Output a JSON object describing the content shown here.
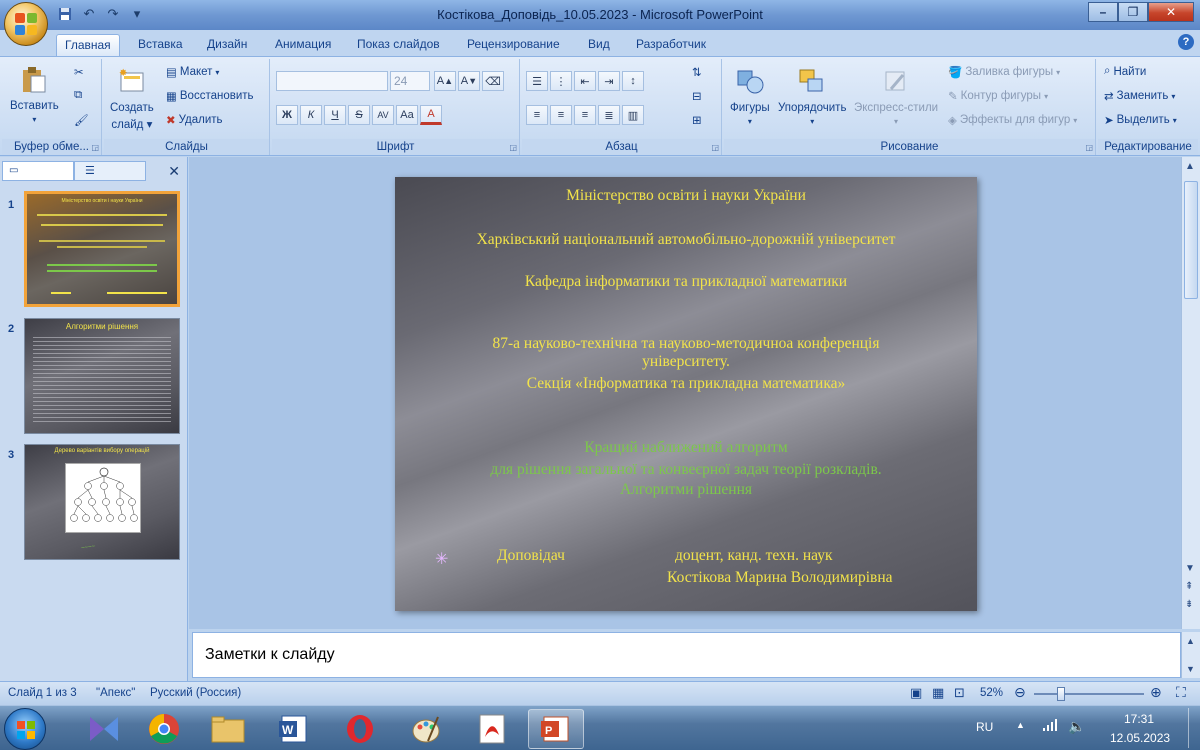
{
  "window": {
    "title": "Костікова_Доповідь_10.05.2023 - Microsoft PowerPoint"
  },
  "tabs": [
    "Главная",
    "Вставка",
    "Дизайн",
    "Анимация",
    "Показ слайдов",
    "Рецензирование",
    "Вид",
    "Разработчик"
  ],
  "active_tab": "Главная",
  "ribbon": {
    "clipboard": {
      "label": "Буфер обме...",
      "paste": "Вставить"
    },
    "slides": {
      "label": "Слайды",
      "create_line1": "Создать",
      "create_line2": "слайд",
      "layout": "Макет",
      "reset": "Восстановить",
      "delete": "Удалить"
    },
    "font": {
      "label": "Шрифт",
      "font_size": "24",
      "bold": "Ж",
      "italic": "К",
      "underline": "Ч",
      "strike": "S",
      "spacing": "AV",
      "case": "Аа"
    },
    "paragraph": {
      "label": "Абзац"
    },
    "drawing": {
      "label": "Рисование",
      "shapes": "Фигуры",
      "arrange": "Упорядочить",
      "quick_styles": "Экспресс-стили",
      "fill": "Заливка фигуры",
      "outline": "Контур фигуры",
      "effects": "Эффекты для фигур"
    },
    "editing": {
      "label": "Редактирование",
      "find": "Найти",
      "replace": "Заменить",
      "select": "Выделить"
    }
  },
  "thumbnails": [
    {
      "num": "1",
      "title": "Міністерство освіти і науки України",
      "selected": true
    },
    {
      "num": "2",
      "title": "Алгоритми рішення",
      "selected": false
    },
    {
      "num": "3",
      "title": "Дерево варіантів вибору операцій",
      "selected": false
    }
  ],
  "slide": {
    "ministry": "Міністерство освіти і науки України",
    "university": "Харківський національний автомобільно-дорожній університет",
    "department": "Кафедра інформатики та прикладної математики",
    "conference_line1": "87-а науково-технічна та науково-методичноа конференція",
    "conference_line2": "університету.",
    "section": "Секція «Інформатика та прикладна математика»",
    "topic_line1": "Кращий наближений алгоритм",
    "topic_line2": "для рішення загальної та конвеєрної задач теорії розкладів.",
    "topic_line3": "Алгоритми рішення",
    "speaker_label": "Доповідач",
    "speaker_title": "доцент, канд. техн. наук",
    "speaker_name": "Костікова Марина Володимирівна"
  },
  "notes": {
    "placeholder": "Заметки к слайду"
  },
  "statusbar": {
    "slide_info": "Слайд 1 из 3",
    "theme": "\"Апекс\"",
    "language": "Русский (Россия)",
    "zoom": "52%"
  },
  "taskbar": {
    "lang": "RU",
    "time": "17:31",
    "date": "12.05.2023"
  },
  "colors": {
    "slide_title_yellow": "#f2e34a",
    "slide_topic_green": "#7cc84a",
    "ribbon_text": "#15428b",
    "thumbnail_selected": "#f2a33a"
  }
}
